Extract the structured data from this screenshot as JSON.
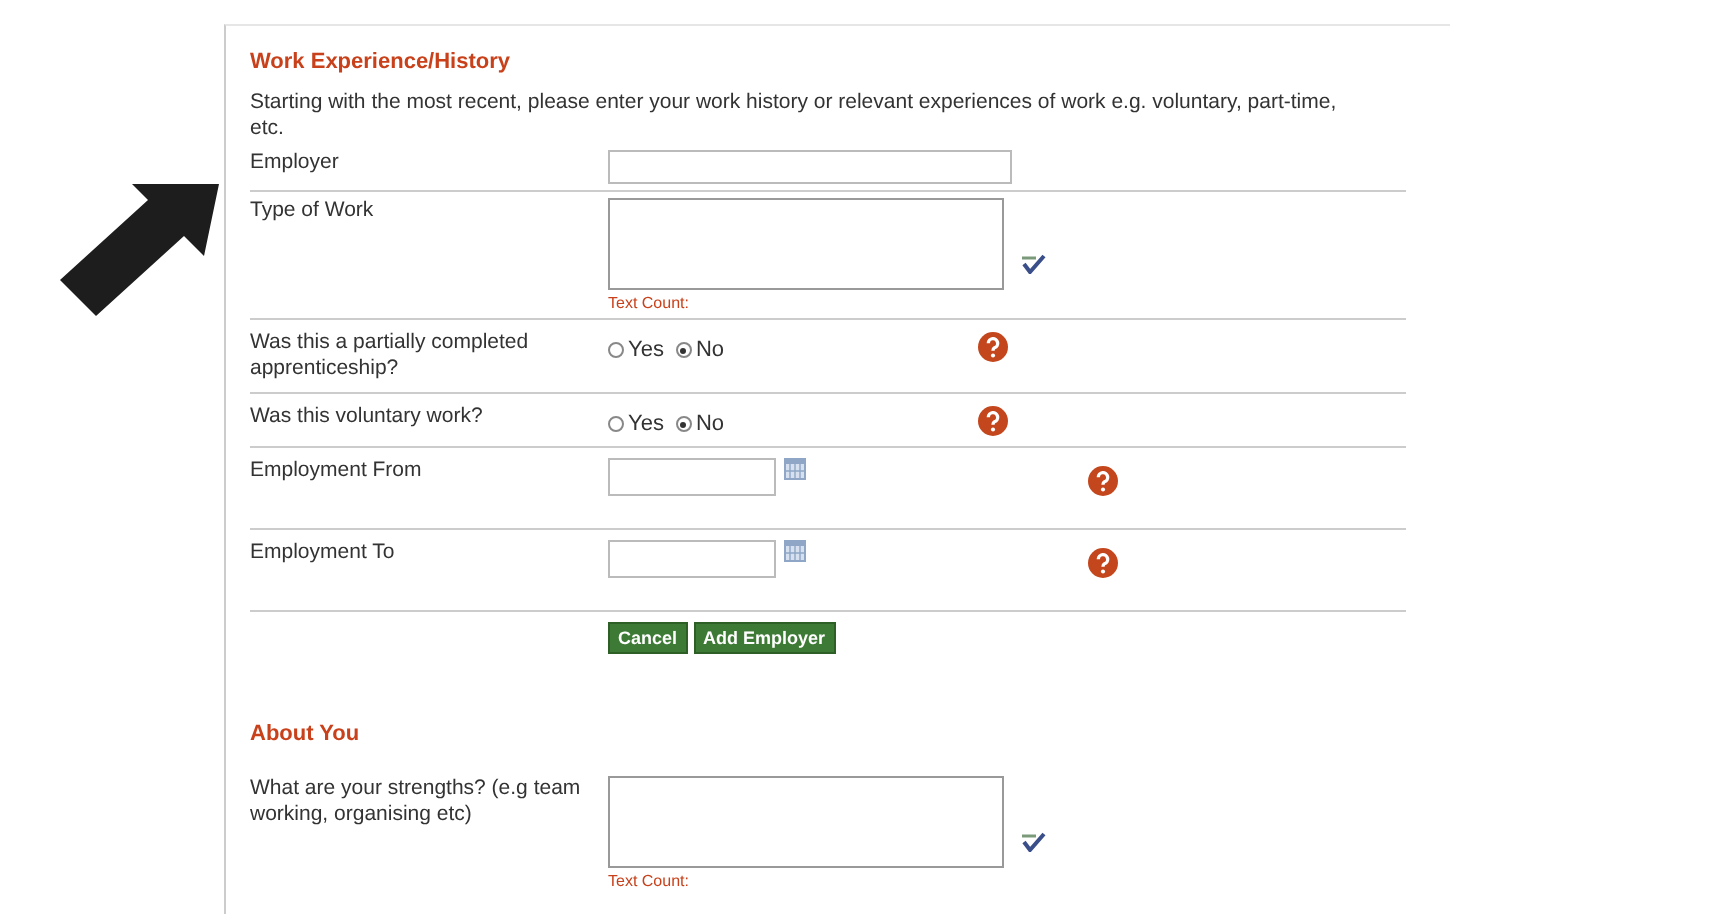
{
  "sections": [
    {
      "title": "Work Experience/History",
      "intro": "Starting with the most recent, please enter your work history or relevant experiences of work e.g. voluntary, part-time, etc.",
      "fields": [
        {
          "kind": "text",
          "label": "Employer"
        },
        {
          "kind": "textarea",
          "label": "Type of Work",
          "counter": "Text Count:"
        },
        {
          "kind": "radio",
          "label": "Was this a partially completed apprenticeship?",
          "options": [
            {
              "label": "Yes",
              "selected": false
            },
            {
              "label": "No",
              "selected": true
            }
          ]
        },
        {
          "kind": "radio",
          "label": "Was this voluntary work?",
          "options": [
            {
              "label": "Yes",
              "selected": false
            },
            {
              "label": "No",
              "selected": true
            }
          ]
        },
        {
          "kind": "date",
          "label": "Employment From"
        },
        {
          "kind": "date",
          "label": "Employment To"
        }
      ],
      "buttons": [
        "Cancel",
        "Add Employer"
      ]
    },
    {
      "title": "About You",
      "fields": [
        {
          "kind": "textarea",
          "label": "What are your strengths? (e.g team working, organising etc)",
          "counter": "Text Count:"
        }
      ]
    }
  ]
}
